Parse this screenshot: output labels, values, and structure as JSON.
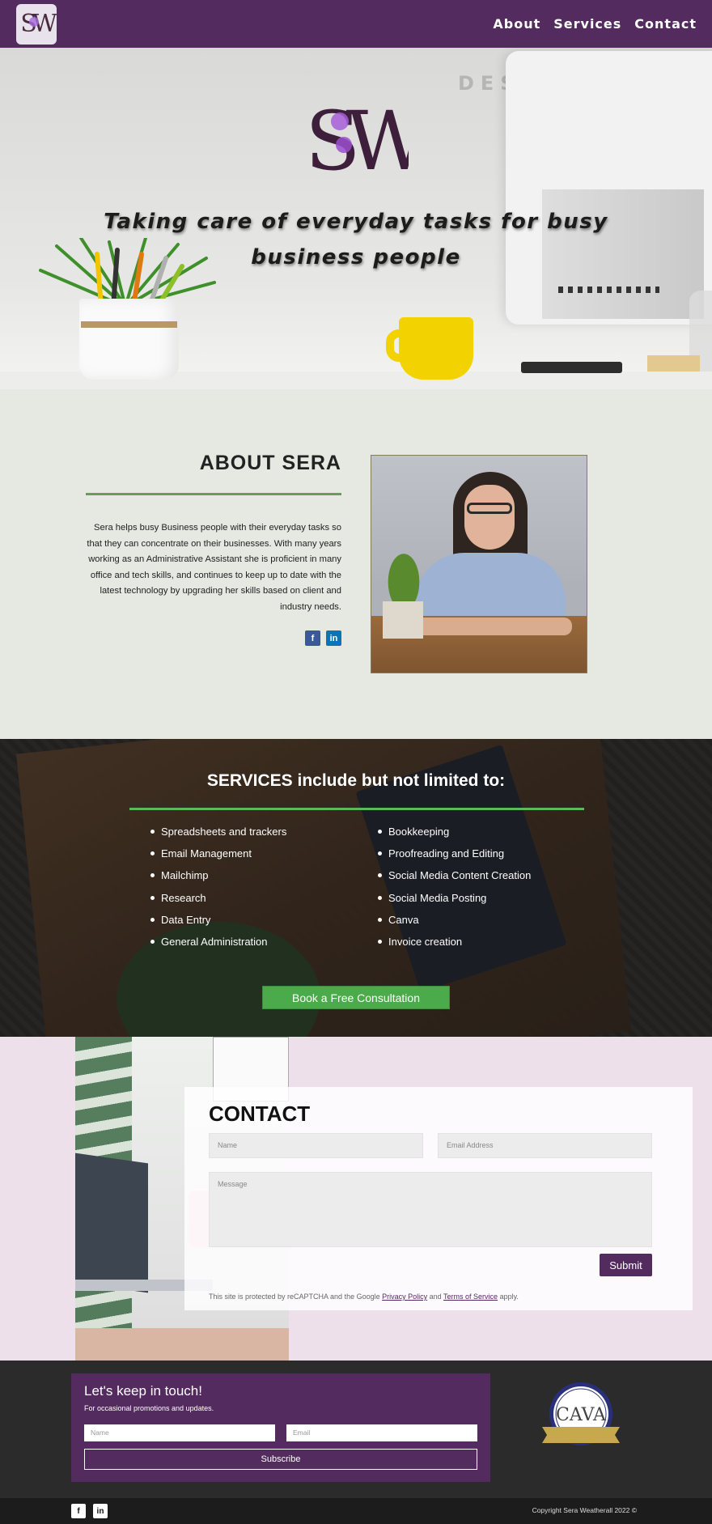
{
  "colors": {
    "brand_purple": "#532b5e",
    "accent_green": "#4bab4a",
    "about_bg": "#e6e8e2",
    "contact_bg": "#eee0eb",
    "footer_bg": "#2b2b2b"
  },
  "header": {
    "logo_text": "SW",
    "nav": [
      {
        "label": "About"
      },
      {
        "label": "Services"
      },
      {
        "label": "Contact"
      }
    ]
  },
  "hero": {
    "wall_text": "DES",
    "logo_text": "SW",
    "title": "Taking care of everyday tasks for busy business people"
  },
  "about": {
    "title": "ABOUT SERA",
    "text": "Sera helps busy Business people with their everyday tasks so that they can concentrate on their businesses. With many years working as an Administrative Assistant she is proficient in many office and tech skills, and continues to keep up to date with the latest technology by upgrading her skills based on client and industry needs.",
    "social": [
      {
        "icon": "facebook-icon",
        "glyph": "f"
      },
      {
        "icon": "linkedin-icon",
        "glyph": "in"
      }
    ]
  },
  "services": {
    "title": "SERVICES include but not limited to:",
    "left": [
      "Spreadsheets and trackers",
      "Email Management",
      "Mailchimp",
      "Research",
      "Data Entry",
      "General Administration"
    ],
    "right": [
      "Bookkeeping",
      "Proofreading and Editing",
      "Social Media Content Creation",
      "Social Media Posting",
      "Canva",
      "Invoice creation"
    ],
    "button_label": "Book a Free Consultation"
  },
  "contact": {
    "title": "CONTACT",
    "name_placeholder": "Name",
    "email_placeholder": "Email Address",
    "message_placeholder": "Message",
    "submit_label": "Submit",
    "recaptcha_prefix": "This site is protected by reCAPTCHA and the Google",
    "privacy_label": "Privacy Policy",
    "and_text": "and",
    "terms_label": "Terms of Service",
    "recaptcha_suffix": "apply."
  },
  "newsletter": {
    "title": "Let's keep in touch!",
    "subtitle": "For occasional promotions and updates.",
    "name_placeholder": "Name",
    "email_placeholder": "Email",
    "button_label": "Subscribe",
    "badge_text": "CAVA"
  },
  "footer": {
    "social": [
      {
        "icon": "facebook-icon",
        "glyph": "f"
      },
      {
        "icon": "linkedin-icon",
        "glyph": "in"
      }
    ],
    "copyright": "Copyright Sera Weatherall 2022 ©"
  }
}
